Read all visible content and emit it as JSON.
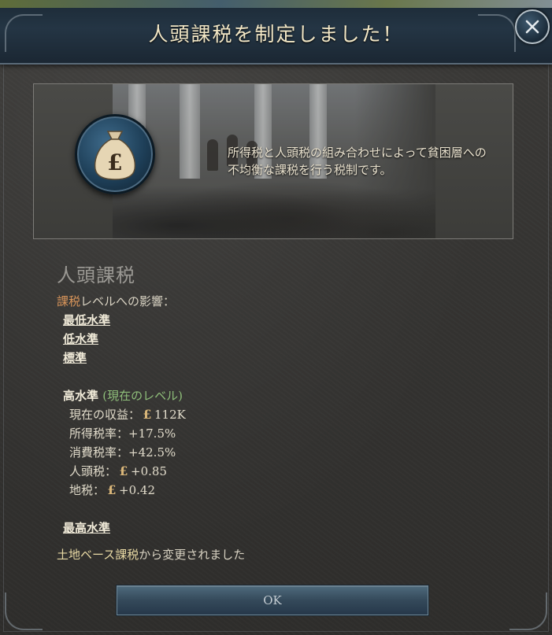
{
  "window": {
    "title": "人頭課税を制定しました！"
  },
  "illustration": {
    "description": "所得税と人頭税の組み合わせによって貧困層への不均衡な課税を行う税制です。"
  },
  "policy": {
    "name": "人頭課税",
    "effect_prefix": "課税",
    "effect_suffix": "レベルへの影響：",
    "levels": [
      {
        "label": "最低水準"
      },
      {
        "label": "低水準"
      },
      {
        "label": "標準"
      }
    ],
    "current_level": {
      "label": "高水準",
      "tag": "(現在のレベル)",
      "stats": [
        {
          "label": "現在の収益：",
          "icon": "pound-icon",
          "value": "112K"
        },
        {
          "label": "所得税率：",
          "icon": "",
          "value": "+17.5%"
        },
        {
          "label": "消費税率：",
          "icon": "",
          "value": "+42.5%"
        },
        {
          "label": "人頭税：",
          "icon": "pound-icon",
          "value": "+0.85"
        },
        {
          "label": "地税：",
          "icon": "pound-icon",
          "value": "+0.42"
        }
      ]
    },
    "max_level": {
      "label": "最高水準"
    },
    "changed_from_name": "土地ベース課税",
    "changed_from_suffix": "から変更されました"
  },
  "buttons": {
    "ok_label": "OK"
  },
  "colors": {
    "accent_orange": "#d9955a",
    "accent_green": "#8fbf7a",
    "title_text": "#f2e7c6"
  }
}
